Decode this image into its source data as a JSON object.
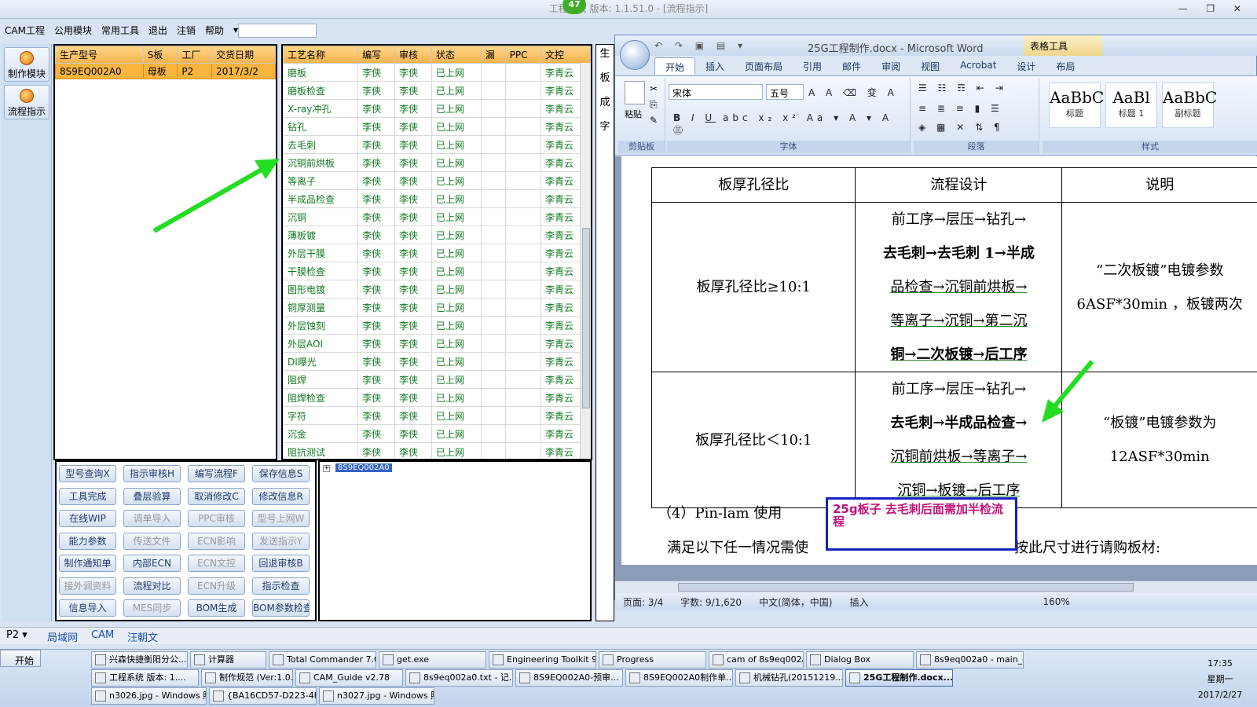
{
  "window": {
    "title": "工程系统  版本: 1.1.51.0 - [流程指示]",
    "badge": "47",
    "controls": "— ❐ ✕"
  },
  "menu": [
    "CAM工程",
    "公用模块",
    "常用工具",
    "退出",
    "注销",
    "帮助",
    "▾"
  ],
  "leftnav": [
    {
      "label": "制作模块"
    },
    {
      "label": "流程指示"
    }
  ],
  "grid1": {
    "headers": [
      "生产型号",
      "S板",
      "工厂",
      "交货日期"
    ],
    "rows": [
      [
        "8S9EQ002A0",
        "母板",
        "P2",
        "2017/3/2"
      ]
    ]
  },
  "grid2": {
    "headers": [
      "工艺名称",
      "编写",
      "审核",
      "状态",
      "漏",
      "PPC",
      "文控"
    ],
    "rows": [
      [
        "磨板",
        "李侠",
        "李侠",
        "已上网",
        "",
        "",
        "李青云"
      ],
      [
        "磨板检查",
        "李侠",
        "李侠",
        "已上网",
        "",
        "",
        "李青云"
      ],
      [
        "X-ray冲孔",
        "李侠",
        "李侠",
        "已上网",
        "",
        "",
        "李青云"
      ],
      [
        "钻孔",
        "李侠",
        "李侠",
        "已上网",
        "",
        "",
        "李青云"
      ],
      [
        "去毛刺",
        "李侠",
        "李侠",
        "已上网",
        "",
        "",
        "李青云"
      ],
      [
        "沉铜前烘板",
        "李侠",
        "李侠",
        "已上网",
        "",
        "",
        "李青云"
      ],
      [
        "等离子",
        "李侠",
        "李侠",
        "已上网",
        "",
        "",
        "李青云"
      ],
      [
        "半成品检查",
        "李侠",
        "李侠",
        "已上网",
        "",
        "",
        "李青云"
      ],
      [
        "沉铜",
        "李侠",
        "李侠",
        "已上网",
        "",
        "",
        "李青云"
      ],
      [
        "薄板镀",
        "李侠",
        "李侠",
        "已上网",
        "",
        "",
        "李青云"
      ],
      [
        "外层干膜",
        "李侠",
        "李侠",
        "已上网",
        "",
        "",
        "李青云"
      ],
      [
        "干膜检查",
        "李侠",
        "李侠",
        "已上网",
        "",
        "",
        "李青云"
      ],
      [
        "图形电镀",
        "李侠",
        "李侠",
        "已上网",
        "",
        "",
        "李青云"
      ],
      [
        "铜厚测量",
        "李侠",
        "李侠",
        "已上网",
        "",
        "",
        "李青云"
      ],
      [
        "外层蚀刻",
        "李侠",
        "李侠",
        "已上网",
        "",
        "",
        "李青云"
      ],
      [
        "外层AOI",
        "李侠",
        "李侠",
        "已上网",
        "",
        "",
        "李青云"
      ],
      [
        "DI曝光",
        "李侠",
        "李侠",
        "已上网",
        "",
        "",
        "李青云"
      ],
      [
        "阻焊",
        "李侠",
        "李侠",
        "已上网",
        "",
        "",
        "李青云"
      ],
      [
        "阻焊检查",
        "李侠",
        "李侠",
        "已上网",
        "",
        "",
        "李青云"
      ],
      [
        "字符",
        "李侠",
        "李侠",
        "已上网",
        "",
        "",
        "李青云"
      ],
      [
        "沉金",
        "李侠",
        "李侠",
        "已上网",
        "",
        "",
        "李青云"
      ],
      [
        "阻抗测试",
        "李侠",
        "李侠",
        "已上网",
        "",
        "",
        "李青云"
      ]
    ]
  },
  "buttons": [
    [
      "型号查询X",
      "指示审核H",
      "编写流程F",
      "保存信息S"
    ],
    [
      "工具完成",
      "叠层验算",
      "取消修改C",
      "修改信息R"
    ],
    [
      "在线WIP",
      "调单导入",
      "PPC审核",
      "型号上网W"
    ],
    [
      "能力参数",
      "传送文件",
      "ECN影响",
      "发送指示Y"
    ],
    [
      "制作通知单",
      "内部ECN",
      "ECN文控",
      "回退审核B"
    ],
    [
      "接外调资料",
      "流程对比",
      "ECN升级",
      "指示检查"
    ],
    [
      "信息导入",
      "MES同步",
      "BOM生成",
      "BOM参数检查"
    ]
  ],
  "buttons_disabled": [
    "调单导入",
    "PPC审核",
    "型号上网W",
    "传送文件",
    "ECN影响",
    "发送指示Y",
    "ECN文控",
    "接外调资料",
    "ECN升级",
    "MES同步"
  ],
  "tree": {
    "root": "8S9EQ002A0"
  },
  "sidecol": [
    "生",
    "板",
    "成",
    "字"
  ],
  "word": {
    "title": "25G工程制作.docx - Microsoft Word",
    "table_tools": "表格工具",
    "tabs": [
      "开始",
      "插入",
      "页面布局",
      "引用",
      "邮件",
      "审阅",
      "视图",
      "Acrobat",
      "设计",
      "布局"
    ],
    "font": "宋体",
    "size": "五号",
    "groups": {
      "clipboard": "剪贴板",
      "font": "字体",
      "paragraph": "段落",
      "styles": "样式",
      "paste": "粘贴"
    },
    "styles": [
      {
        "sample": "AaBbC",
        "label": "标题"
      },
      {
        "sample": "AaBl",
        "label": "标题 1"
      },
      {
        "sample": "AaBbC",
        "label": "副标题"
      }
    ],
    "doc": {
      "headers": [
        "板厚孔径比",
        "流程设计",
        "说明"
      ],
      "row1": {
        "c0": "板厚孔径比≥10:1",
        "c1": [
          "前工序→层压→钻孔→",
          "去毛刺→去毛刺 1→半成",
          "品检查→沉铜前烘板→",
          "等离子→沉铜→第二沉",
          "铜→二次板镀→后工序"
        ],
        "c2": [
          "“二次板镀”电镀参数",
          "6ASF*30min ，板镀两次"
        ]
      },
      "row2": {
        "c0": "板厚孔径比＜10:1",
        "c1": [
          "前工序→层压→钻孔→",
          "去毛刺→半成品检查→",
          "沉铜前烘板→等离子→",
          "沉铜→板镀→后工序"
        ],
        "c2": [
          "“板镀”电镀参数为",
          "12ASF*30min"
        ]
      },
      "pinlam": "（4）Pin-lam 使用",
      "satisfy": "满足以下任一情况需使",
      "satisfy2": "按此尺寸进行请购板材:",
      "callout": "25g板子  去毛刺后面需加半检流程"
    },
    "status": [
      "页面: 3/4",
      "字数: 9/1,620",
      "中文(简体，中国)",
      "插入"
    ],
    "zoom": "160%"
  },
  "pbar": [
    "P2 ▾",
    "局域网",
    "CAM",
    "汪朝文"
  ],
  "taskbar": {
    "start": "开始",
    "row1": [
      "兴森快捷衡阳分公...",
      "计算器",
      "Total Commander 7.0 ...",
      "get.exe",
      "Engineering Toolkit 9....",
      "Progress",
      "cam of 8s9eq002a0",
      "Dialog Box",
      "8s9eq002a0 - main_qa"
    ],
    "row2": [
      "工程系统  版本: 1....",
      "制作规范 (Ver:1.0.6)",
      "CAM_Guide v2.78",
      "8s9eq002a0.txt - 记...",
      "8S9EQ002A0-预审...",
      "8S9EQ002A0制作单...",
      "机械钻孔(20151219...",
      "25G工程制作.docx..."
    ],
    "row3": [
      "n3026.jpg - Windows 照...",
      "{BA16CD57-D223-4FEB-...",
      "n3027.jpg - Windows 照..."
    ],
    "time": "17:35",
    "weekday": "星期一",
    "date": "2017/2/27"
  },
  "colors": {
    "accent": "#3563c9",
    "rowhighlight": "#f7b53e",
    "arrow": "#22dd22",
    "callout": "#1522c4"
  }
}
